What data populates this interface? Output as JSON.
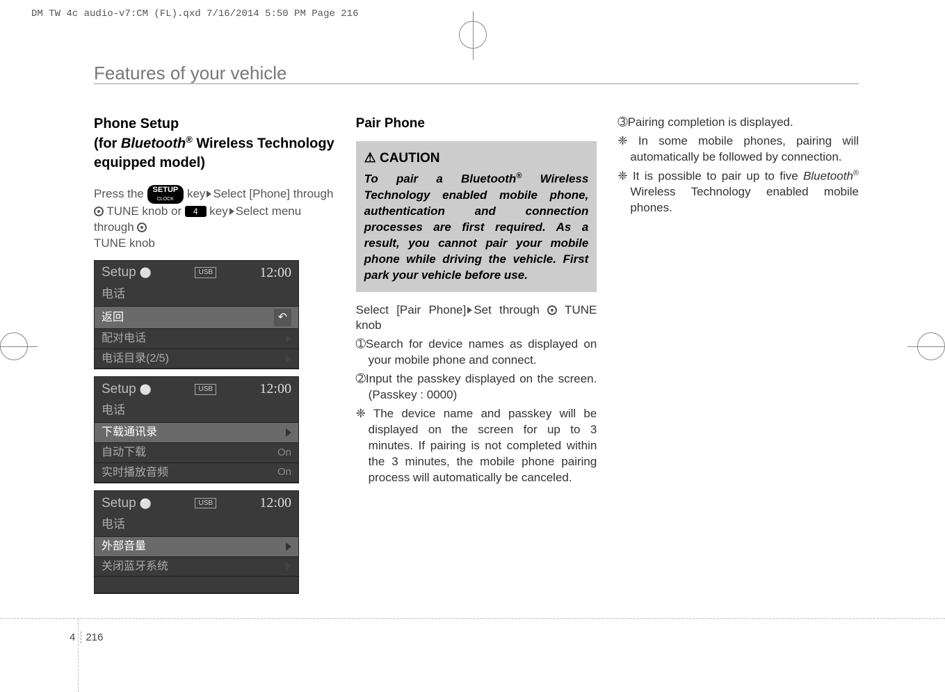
{
  "header_line": "DM TW 4c audio-v7:CM (FL).qxd  7/16/2014  5:50 PM  Page 216",
  "section_title": "Features of your vehicle",
  "col1": {
    "heading_l1": "Phone Setup",
    "heading_l2_pre": "(for ",
    "heading_l2_bt": "Bluetooth",
    "heading_l2_sup": "®",
    "heading_l2_post": " Wireless Technology equipped model)",
    "press_pre": "Press the ",
    "setup_top": "SETUP",
    "setup_bot": "CLOCK",
    "press_mid1": " key",
    "select1": "Select [Phone] through ",
    "tune1": " TUNE knob or ",
    "key4": "4",
    "key_txt": " key",
    "select2": "Select menu through ",
    "tune2": " TUNE knob"
  },
  "ss": {
    "setup_label": "Setup",
    "usb": "USB",
    "time": "12:00",
    "phone_cn": "电话",
    "s1_r1": "返回",
    "s1_r2": "配对电话",
    "s1_r3": "电话目录(2/5)",
    "s2_r1": "下载通讯录",
    "s2_r2": "自动下载",
    "s2_r2_val": "On",
    "s2_r3": "实时播放音频",
    "s2_r3_val": "On",
    "s3_r1": "外部音量",
    "s3_r2": "关闭蓝牙系统"
  },
  "col2": {
    "heading": "Pair Phone",
    "caution_label": "CAUTION",
    "caution_pre": "To pair a Bluetooth",
    "caution_sup": "®",
    "caution_post": " Wireless Technology enabled mobile phone, authentication and connection processes are first required. As a result, you cannot pair your mobile phone while driving the vehicle. First park your vehicle before use.",
    "select_pre": "Select [Pair Phone]",
    "select_mid": "Set through ",
    "select_post": " TUNE knob",
    "n1_num": "➀",
    "n1": "Search for device names as displayed on your mobile phone and connect.",
    "n2_num": "➁",
    "n2": "Input the passkey displayed on the screen. (Passkey : 0000)",
    "snow1_sym": "❈",
    "snow1": " The device name and passkey will be displayed on the screen for up to 3 minutes. If pairing is not completed within the 3 minutes, the mobile phone pairing process will automatically be canceled."
  },
  "col3": {
    "n3_num": "➂",
    "n3": "Pairing completion is displayed.",
    "snow1_sym": "❈",
    "snow1": " In some mobile phones, pairing will automatically be followed by connection.",
    "snow2_sym": "❈",
    "snow2_pre": " It is possible to pair up to five ",
    "snow2_bt": "Bluetooth",
    "snow2_sup": "®",
    "snow2_post": " Wireless Technology enabled mobile phones."
  },
  "footer": {
    "chapter": "4",
    "page": "216"
  }
}
